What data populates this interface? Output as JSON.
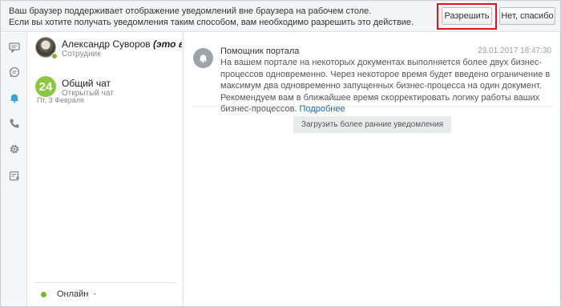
{
  "notification_bar": {
    "line1": "Ваш браузер поддерживает отображение уведомлений вне браузера на рабочем столе.",
    "line2": "Если вы хотите получать уведомления таким способом, вам необходимо разрешить это действие.",
    "allow_label": "Разрешить",
    "decline_label": "Нет, спасибо",
    "highlight_color": "#e0141e"
  },
  "rail": {
    "icons": [
      "chat-bubble-icon",
      "search-history-icon",
      "bell-icon",
      "phone-icon",
      "gear-icon",
      "settings-list-icon"
    ],
    "active_color": "#2fa4e7"
  },
  "contacts": {
    "items": [
      {
        "name": "Александр Суворов",
        "name_suffix": "(это в...",
        "subtitle": "Сотрудник",
        "online": true
      },
      {
        "avatar_text": "24",
        "name": "Общий чат",
        "subtitle": "Открытый чат"
      }
    ],
    "date_separator": "Пт, 3 Февраля",
    "status": {
      "label": "Онлайн",
      "caret": "⌄",
      "color": "#7cb82f"
    }
  },
  "notification": {
    "author": "Помощник портала",
    "date": "23.01.2017 18:47:30",
    "text": "На вашем портале на некоторых документах выполняется более двух бизнес-процессов одновременно. Через некоторое время будет введено ограничение в максимум два одновременно запущенных бизнес-процесса на один документ. Рекомендуем вам в ближайшее время скорректировать логику работы ваших бизнес-процессов.",
    "more_link": "Подробнее"
  },
  "load_more_label": "Загрузить более ранние уведомления"
}
